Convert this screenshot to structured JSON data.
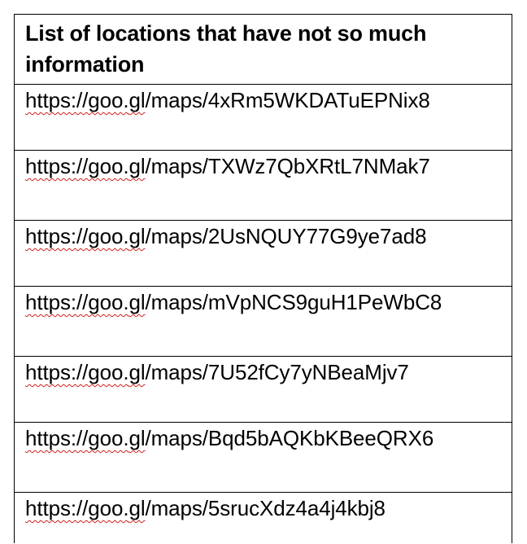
{
  "table": {
    "header": "List of locations that have not so much information",
    "rows": [
      {
        "proto": "https://goo.",
        "gl": "gl",
        "rest": "/maps/4xRm5WKDATuEPNix8"
      },
      {
        "proto": "https://goo.",
        "gl": "gl",
        "rest": "/maps/TXWz7QbXRtL7NMak7"
      },
      {
        "proto": "https://goo.",
        "gl": "gl",
        "rest": "/maps/2UsNQUY77G9ye7ad8"
      },
      {
        "proto": "https://goo.",
        "gl": "gl",
        "rest": "/maps/mVpNCS9guH1PeWbC8"
      },
      {
        "proto": "https://goo.",
        "gl": "gl",
        "rest": "/maps/7U52fCy7yNBeaMjv7"
      },
      {
        "proto": "https://goo.",
        "gl": "gl",
        "rest": "/maps/Bqd5bAQKbKBeeQRX6"
      },
      {
        "proto": "https://goo.",
        "gl": "gl",
        "rest": "/maps/5srucXdz4a4j4kbj8"
      }
    ]
  },
  "colors": {
    "spellcheck_underline": "#d02020",
    "border": "#000000"
  }
}
